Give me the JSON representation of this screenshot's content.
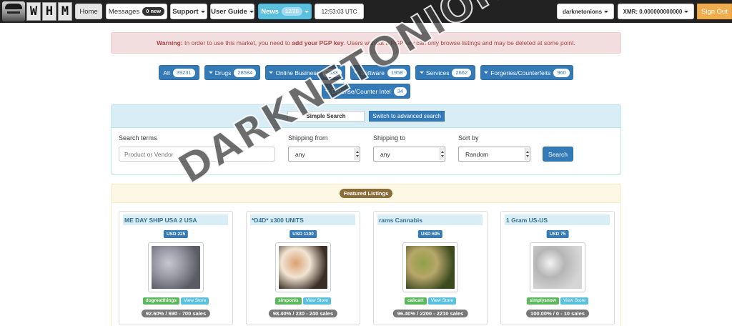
{
  "navbar": {
    "logo_letters": [
      "W",
      "H",
      "M"
    ],
    "home": "Home",
    "messages": {
      "label": "Messages",
      "badge": "0 new"
    },
    "support": "Support",
    "user_guide": "User Guide",
    "news": {
      "label": "News",
      "badge": "12/20"
    },
    "time": "12:53:03 UTC",
    "username": "darknetonions",
    "wallet": "XMR: 0.000000000000",
    "sign_out": "Sign Out"
  },
  "alert": {
    "strong": "Warning:",
    "text1": " In order to use this market, you need to ",
    "link": "add your PGP key",
    "text2": ". Users without a PGP key can only browse listings and may be deleted at some point."
  },
  "categories": [
    {
      "label": "All",
      "count": "39231",
      "dropdown": false
    },
    {
      "label": "Drugs",
      "count": "28584",
      "dropdown": true
    },
    {
      "label": "Online Business",
      "count": "5033",
      "dropdown": true
    },
    {
      "label": "Software",
      "count": "1958",
      "dropdown": true
    },
    {
      "label": "Services",
      "count": "2662",
      "dropdown": true
    },
    {
      "label": "Forgeries/Counterfeits",
      "count": "960",
      "dropdown": true
    },
    {
      "label": "Defense/Counter Intel",
      "count": "34",
      "dropdown": true
    }
  ],
  "search": {
    "simple": "Simple Search",
    "advanced": "Switch to advanced search",
    "terms_label": "Search terms",
    "terms_placeholder": "Product or Vendor",
    "shipping_from_label": "Shipping from",
    "shipping_from_value": "any",
    "shipping_to_label": "Shipping to",
    "shipping_to_value": "any",
    "sort_label": "Sort by",
    "sort_value": "Random",
    "button": "Search"
  },
  "featured": {
    "label": "Featured Listings",
    "listings": [
      {
        "title": "ME DAY SHIP USA 2 USA",
        "price": "USD 225",
        "vendor": "dogreatthings",
        "store": "View Store",
        "sales": "92.60% / 690 - 700 sales",
        "thumb": [
          "#5b5b66",
          "#c7c7d2",
          "#9a9aa6"
        ]
      },
      {
        "title": "*D4D* x300 UNITS",
        "price": "USD 1100",
        "vendor": "simponis",
        "store": "View Store",
        "sales": "98.40% / 230 - 240 sales",
        "thumb": [
          "#3b2e25",
          "#d9a273",
          "#f2e4d2"
        ]
      },
      {
        "title": "rams Cannabis",
        "price": "USD 695",
        "vendor": "calicart",
        "store": "View Store",
        "sales": "96.40% / 2200 - 2210 sales",
        "thumb": [
          "#3b4a1f",
          "#8da046",
          "#b8a66a"
        ]
      },
      {
        "title": "1 Gram US-US",
        "price": "USD 75",
        "vendor": "simplysnow",
        "store": "View Store",
        "sales": "100.00% / 0 - 10 sales",
        "thumb": [
          "#d5d5d5",
          "#f3f3f3",
          "#b5b5b5"
        ]
      }
    ]
  },
  "watermark": "DARKNETONIONS.COM",
  "colors": {
    "primary": "#337ab7",
    "info": "#5bc0de",
    "success": "#5cb85c",
    "warning": "#f0ad4e",
    "danger_text": "#a94442"
  }
}
